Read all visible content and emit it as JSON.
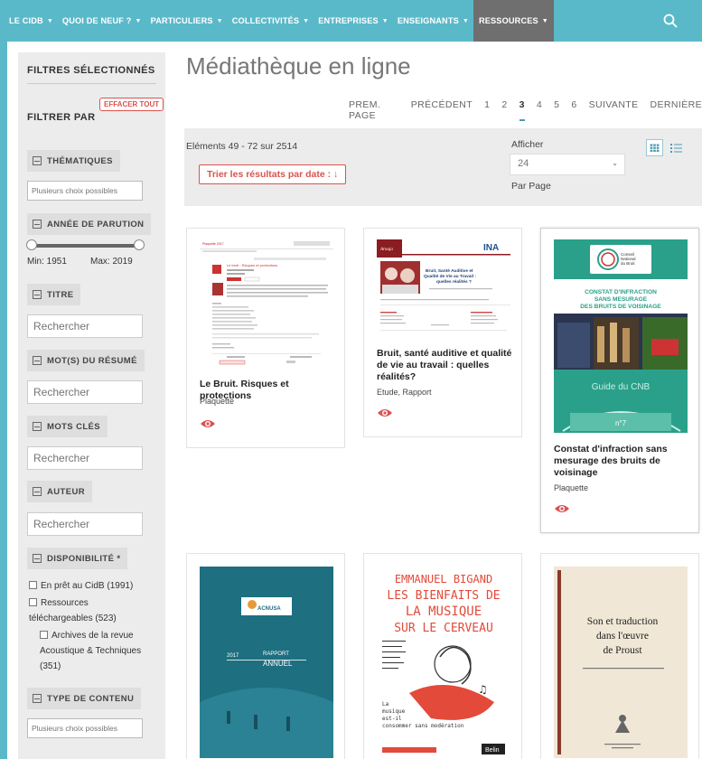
{
  "nav": {
    "items": [
      {
        "label": "LE CIDB",
        "active": false
      },
      {
        "label": "QUOI DE NEUF ?",
        "active": false
      },
      {
        "label": "PARTICULIERS",
        "active": false
      },
      {
        "label": "COLLECTIVITÉS",
        "active": false
      },
      {
        "label": "ENTREPRISES",
        "active": false
      },
      {
        "label": "ENSEIGNANTS",
        "active": false
      },
      {
        "label": "RESSOURCES",
        "active": true
      }
    ],
    "search_icon": "search-icon"
  },
  "sidebar": {
    "selected_title": "FILTRES SÉLECTIONNÉS",
    "clear_all": "EFFACER TOUT",
    "filter_by": "FILTRER PAR",
    "thematique": {
      "label": "THÉMATIQUES",
      "placeholder": "Plusieurs choix possibles"
    },
    "annee": {
      "label": "ANNÉE DE PARUTION",
      "min_label": "Min: 1951",
      "max_label": "Max: 2019",
      "min": 1951,
      "max": 2019
    },
    "titre": {
      "label": "TITRE",
      "placeholder": "Rechercher"
    },
    "resume": {
      "label": "MOT(S) DU RÉSUMÉ",
      "placeholder": "Rechercher"
    },
    "mots_cles": {
      "label": "MOTS CLÉS",
      "placeholder": "Rechercher"
    },
    "auteur": {
      "label": "AUTEUR",
      "placeholder": "Rechercher"
    },
    "disponibilite": {
      "label": "DISPONIBILITÉ *",
      "options": [
        "En prêt au CidB (1991)",
        "Ressources",
        "téléchargeables (523)",
        "Archives de la revue",
        "Acoustique & Techniques",
        "(351)"
      ]
    },
    "type_contenu": {
      "label": "TYPE DE CONTENU",
      "placeholder": "Plusieurs choix possibles"
    }
  },
  "main": {
    "title": "Médiathèque en ligne",
    "pager": [
      "PREM. PAGE",
      "PRÉCÉDENT",
      "1",
      "2",
      "3",
      "4",
      "5",
      "6",
      "SUIVANTE",
      "DERNIÈRE"
    ],
    "current_page": "3",
    "count_text": "Eléments  49 - 72  sur  2514",
    "sort_label": "Trier les résultats par date :  ↓",
    "afficher": "Afficher",
    "per_page_value": "24",
    "par_page": "Par Page",
    "colors": {
      "accent": "#5ab9c9",
      "red": "#d9534f",
      "active_nav": "#6f6f6f"
    }
  },
  "cards": [
    {
      "title": "Le Bruit. Risques et protections",
      "type": "Plaquette",
      "thumb": {
        "header": "Plaquette 2017",
        "doc_title": "Le bruit : Risques et protections"
      }
    },
    {
      "title": "Bruit, santé auditive et qualité de vie au travail : quelles réalités?",
      "type": "Etude, Rapport",
      "thumb": {
        "logo": "INA",
        "doc_title": "Bruit, Santé Auditive et Qualité de Vie au Travail : quelles réalités ?"
      }
    },
    {
      "title": "Constat d'infraction sans mesurage des bruits de voisinage",
      "type": "Plaquette",
      "thumb": {
        "org": "Conseil National du Bruit",
        "doc_title": "CONSTAT D'INFRACTION SANS MESURAGE DES BRUITS DE VOISINAGE",
        "guide": "Guide du CNB",
        "number": "n°7"
      }
    },
    {
      "title": "",
      "type": "",
      "thumb": {
        "logo": "ACNUSA",
        "year": "2017",
        "doc_title": "RAPPORT ANNUEL"
      }
    },
    {
      "title": "",
      "type": "",
      "thumb": {
        "author": "EMMANUEL BIGAND",
        "line1": "LES BIENFAITS DE",
        "line2": "LA MUSIQUE",
        "line3": "SUR LE CERVEAU",
        "publisher": "Belin"
      }
    },
    {
      "title": "",
      "type": "",
      "thumb": {
        "line1": "Son et traduction",
        "line2": "dans l'œuvre",
        "line3": "de Proust"
      }
    }
  ]
}
